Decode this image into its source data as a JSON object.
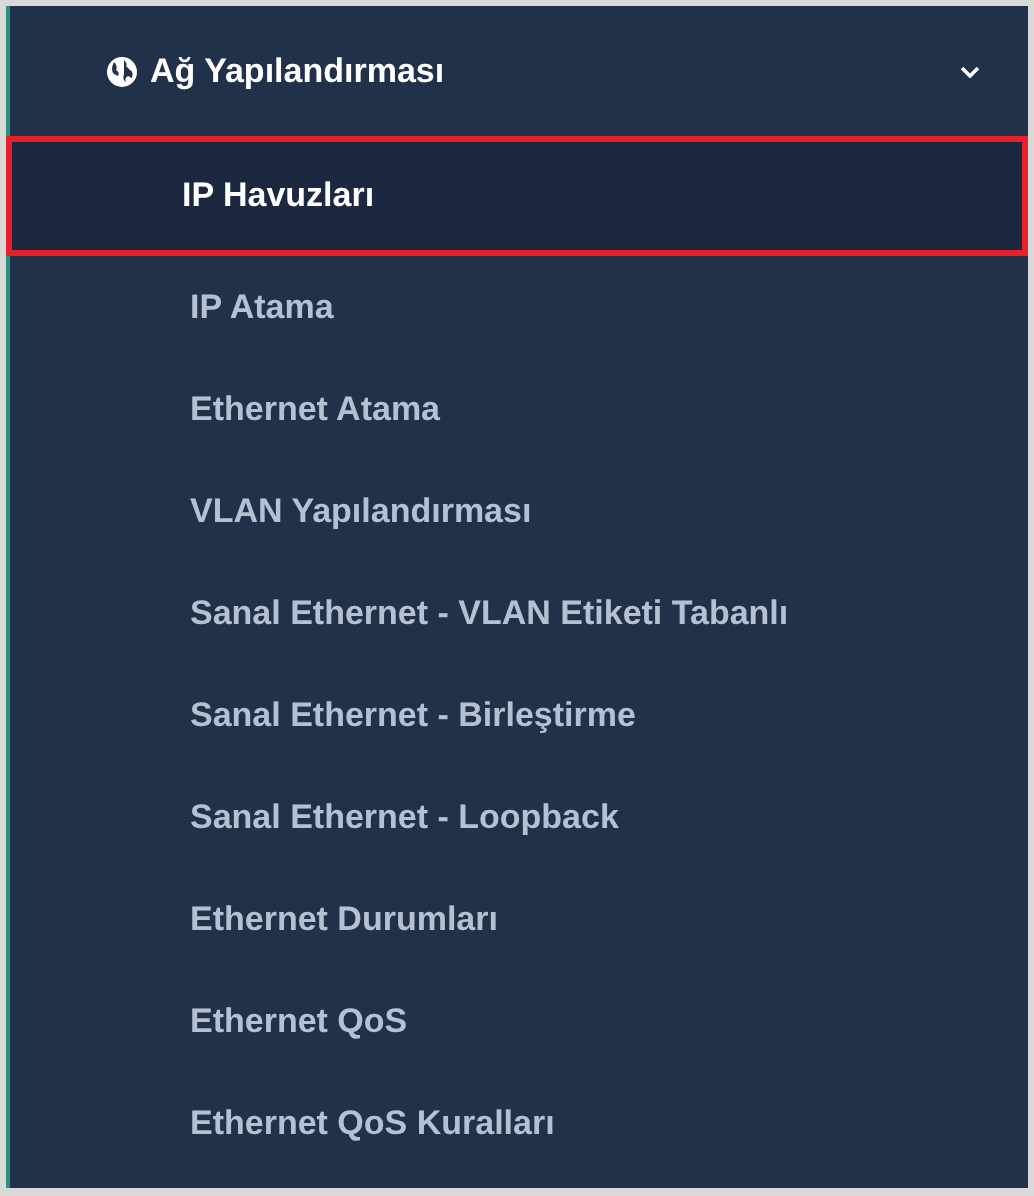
{
  "section": {
    "title": "Ağ Yapılandırması",
    "expanded": true
  },
  "items": [
    {
      "label": "IP Havuzları",
      "selected": true
    },
    {
      "label": "IP Atama",
      "selected": false
    },
    {
      "label": "Ethernet Atama",
      "selected": false
    },
    {
      "label": "VLAN Yapılandırması",
      "selected": false
    },
    {
      "label": "Sanal Ethernet - VLAN Etiketi Tabanlı",
      "selected": false
    },
    {
      "label": "Sanal Ethernet - Birleştirme",
      "selected": false
    },
    {
      "label": "Sanal Ethernet - Loopback",
      "selected": false
    },
    {
      "label": "Ethernet Durumları",
      "selected": false
    },
    {
      "label": "Ethernet QoS",
      "selected": false
    },
    {
      "label": "Ethernet QoS Kuralları",
      "selected": false
    }
  ]
}
